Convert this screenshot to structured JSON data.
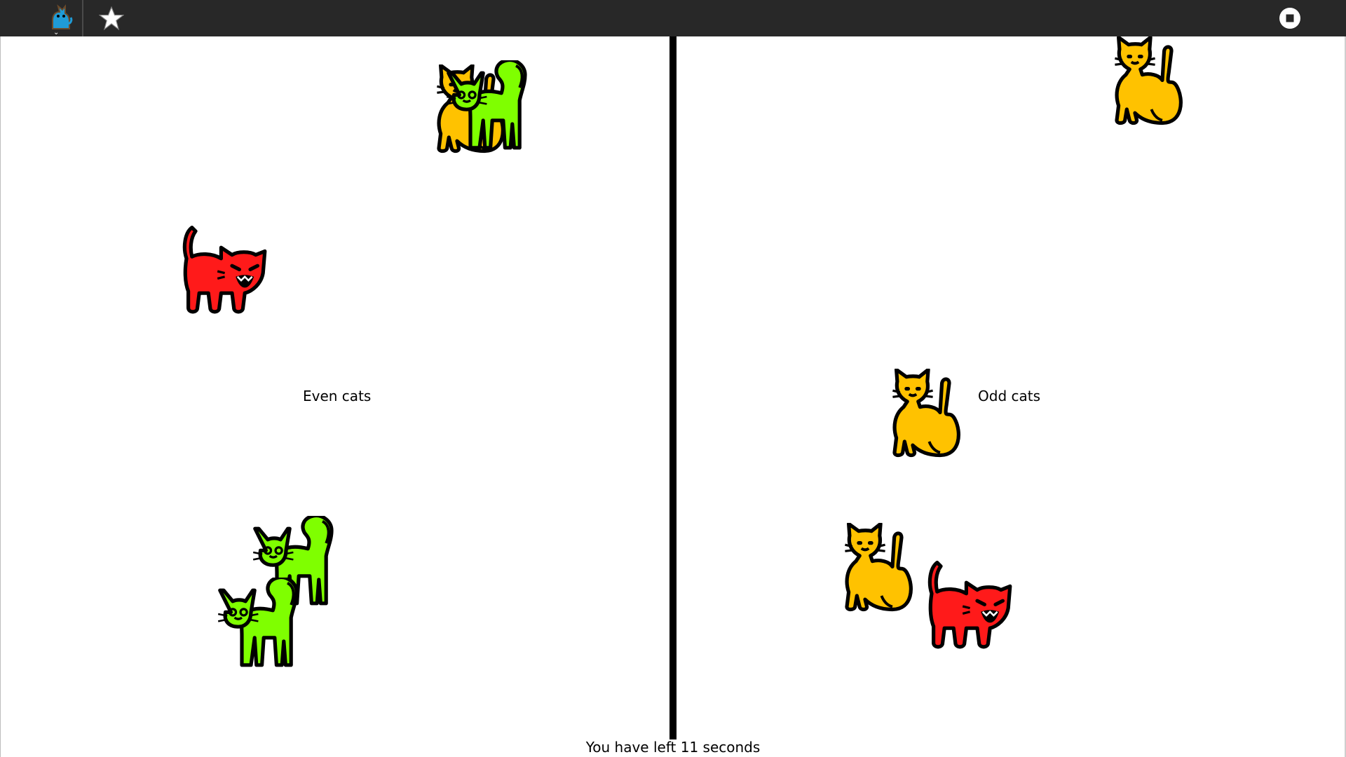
{
  "toolbar": {
    "activity_icon": "cat-activity-icon",
    "star_icon": "star-icon",
    "stop_icon": "stop-icon",
    "caret_icon": "chevron-down-icon"
  },
  "zones": {
    "even_label": "Even cats",
    "odd_label": "Odd cats"
  },
  "timer": {
    "prefix": "You have left",
    "seconds": "11",
    "suffix": "seconds"
  },
  "cats": {
    "even": [
      {
        "kind": "sitting",
        "color": "#ffc200"
      },
      {
        "kind": "standing",
        "color": "#7fff00"
      },
      {
        "kind": "angry",
        "color": "#ff1a1a"
      },
      {
        "kind": "standing",
        "color": "#7fff00"
      },
      {
        "kind": "standing",
        "color": "#7fff00"
      }
    ],
    "odd": [
      {
        "kind": "sitting",
        "color": "#ffc200"
      },
      {
        "kind": "sitting",
        "color": "#ffc200"
      },
      {
        "kind": "sitting",
        "color": "#ffc200"
      },
      {
        "kind": "angry",
        "color": "#ff1a1a"
      }
    ]
  },
  "colors": {
    "toolbar": "#282828",
    "divider": "#000000",
    "activity_icon": "#1f9bd6"
  }
}
